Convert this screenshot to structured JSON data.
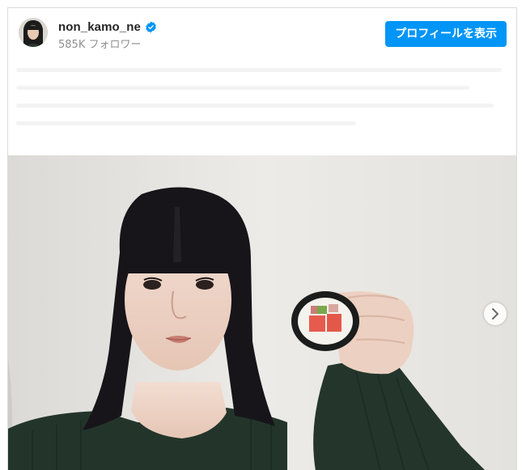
{
  "post": {
    "username": "non_kamo_ne",
    "verified": true,
    "followers_text": "585K フォロワー",
    "profile_button_label": "プロフィールを表示"
  },
  "icons": {
    "verified": "verified-badge-icon",
    "next": "chevron-right-icon"
  },
  "colors": {
    "accent": "#0095f6",
    "username": "#262626",
    "secondary_text": "#8e8e8e",
    "border": "#dbdbdb"
  }
}
